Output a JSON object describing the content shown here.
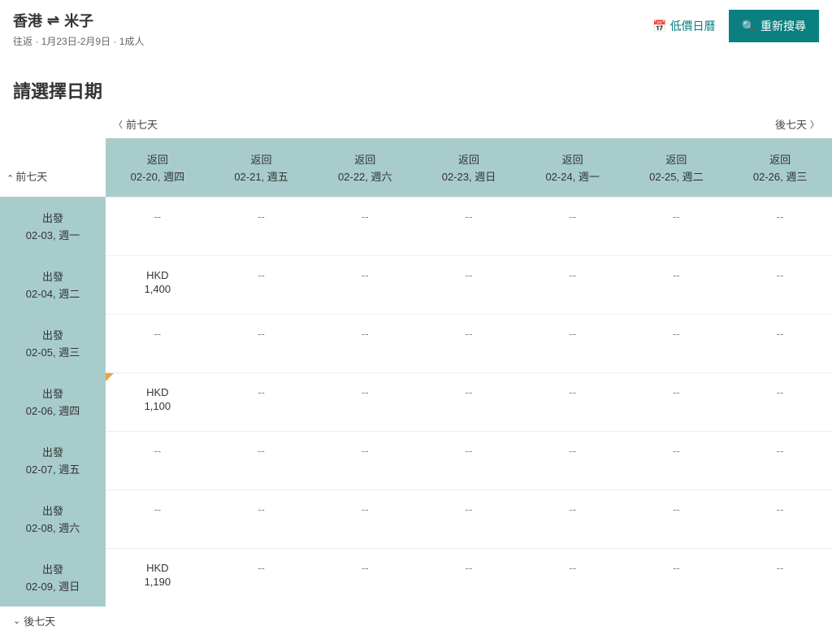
{
  "header": {
    "origin": "香港",
    "destination": "米子",
    "trip_type": "往返",
    "dates": "1月23日-2月9日",
    "pax": "1成人",
    "calendar_link": "低價日曆",
    "search_btn": "重新搜尋"
  },
  "section_title": "請選擇日期",
  "nav": {
    "prev7_top": "前七天",
    "next7_top": "後七天",
    "prev7_left": "前七天",
    "next7_bottom": "後七天"
  },
  "columns": [
    {
      "label_top": "返回",
      "label_bot": "02-20, 週四"
    },
    {
      "label_top": "返回",
      "label_bot": "02-21, 週五"
    },
    {
      "label_top": "返回",
      "label_bot": "02-22, 週六"
    },
    {
      "label_top": "返回",
      "label_bot": "02-23, 週日"
    },
    {
      "label_top": "返回",
      "label_bot": "02-24, 週一"
    },
    {
      "label_top": "返回",
      "label_bot": "02-25, 週二"
    },
    {
      "label_top": "返回",
      "label_bot": "02-26, 週三"
    }
  ],
  "rows": [
    {
      "label_top": "出發",
      "label_bot": "02-03, 週一",
      "prices": [
        "--",
        "--",
        "--",
        "--",
        "--",
        "--",
        "--"
      ]
    },
    {
      "label_top": "出發",
      "label_bot": "02-04, 週二",
      "prices": [
        "HKD|1,400",
        "--",
        "--",
        "--",
        "--",
        "--",
        "--"
      ]
    },
    {
      "label_top": "出發",
      "label_bot": "02-05, 週三",
      "prices": [
        "--",
        "--",
        "--",
        "--",
        "--",
        "--",
        "--"
      ]
    },
    {
      "label_top": "出發",
      "label_bot": "02-06, 週四",
      "prices": [
        "HKD|1,100",
        "--",
        "--",
        "--",
        "--",
        "--",
        "--"
      ],
      "marker": true
    },
    {
      "label_top": "出發",
      "label_bot": "02-07, 週五",
      "prices": [
        "--",
        "--",
        "--",
        "--",
        "--",
        "--",
        "--"
      ]
    },
    {
      "label_top": "出發",
      "label_bot": "02-08, 週六",
      "prices": [
        "--",
        "--",
        "--",
        "--",
        "--",
        "--",
        "--"
      ]
    },
    {
      "label_top": "出發",
      "label_bot": "02-09, 週日",
      "prices": [
        "HKD|1,190",
        "--",
        "--",
        "--",
        "--",
        "--",
        "--"
      ]
    }
  ]
}
